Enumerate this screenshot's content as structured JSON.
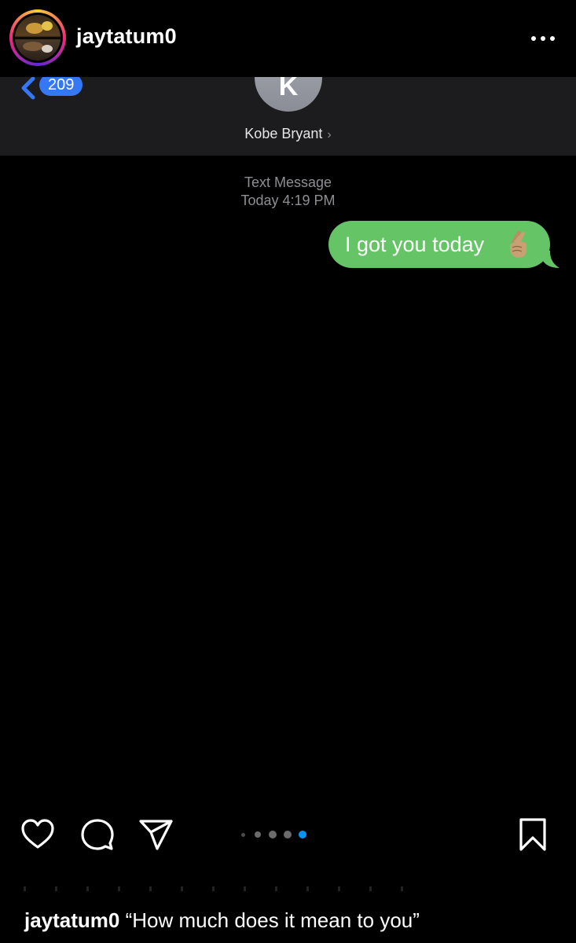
{
  "post": {
    "username": "jaytatum0",
    "avatar_icon": "profile-photo",
    "more_icon": "more-horizontal-icon"
  },
  "screenshot": {
    "back_badge": "209",
    "contact_initial": "K",
    "contact_name": "Kobe Bryant",
    "contact_chevron": "›",
    "meta_service": "Text Message",
    "meta_time": "Today 4:19 PM",
    "message_text": "I got you today",
    "message_emoji": "crossed-fingers",
    "bubble_color": "#65c466",
    "badge_color": "#3478f6"
  },
  "actions": {
    "like_icon": "heart-icon",
    "comment_icon": "comment-icon",
    "share_icon": "send-icon",
    "save_icon": "bookmark-icon",
    "carousel_total": 5,
    "carousel_active": 5,
    "active_dot_color": "#0095f6"
  },
  "caption": {
    "username": "jaytatum0",
    "text": "“How much does it mean to you”"
  }
}
